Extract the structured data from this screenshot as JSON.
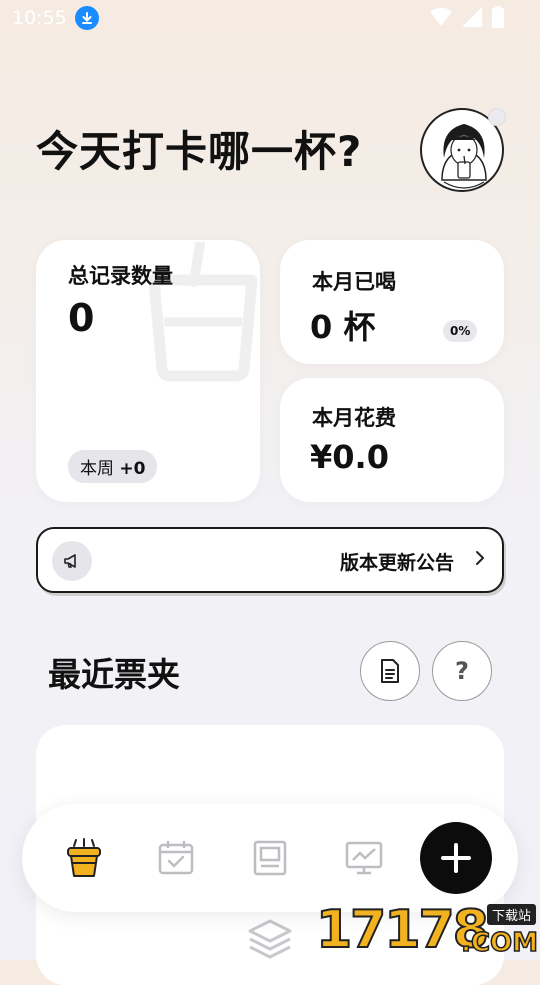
{
  "status_bar": {
    "time": "10:55"
  },
  "header": {
    "title": "今天打卡哪一杯?"
  },
  "stats": {
    "total": {
      "label": "总记录数量",
      "value": "0",
      "week_prefix": "本周",
      "week_delta": "+0"
    },
    "month_drinks": {
      "label": "本月已喝",
      "value": "0 杯",
      "percent": "0%"
    },
    "month_spend": {
      "label": "本月花费",
      "value": "¥0.0"
    }
  },
  "notice": {
    "text": "版本更新公告"
  },
  "section": {
    "title": "最近票夹"
  },
  "bottom_nav": {
    "items": [
      {
        "icon": "drink-cup-icon",
        "active": true
      },
      {
        "icon": "calendar-check-icon",
        "active": false
      },
      {
        "icon": "receipt-icon",
        "active": false
      },
      {
        "icon": "chart-monitor-icon",
        "active": false
      }
    ],
    "fab_icon": "plus-icon"
  },
  "watermark": {
    "digits": "17178",
    "tag": "下载站",
    "suffix": ".COM"
  },
  "colors": {
    "accent_gold": "#f3b21f",
    "fab_bg": "#0c0c0c",
    "download_blue": "#1a8cff"
  }
}
